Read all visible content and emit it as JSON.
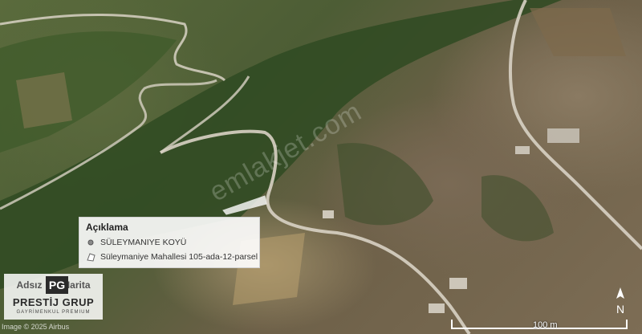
{
  "legend": {
    "title": "Açıklama",
    "items": [
      {
        "label": "SÜLEYMANIYE KOYÜ",
        "icon": "pin-icon"
      },
      {
        "label": "Süleymaniye Mahallesi 105-ada-12-parsel",
        "icon": "polygon-icon"
      }
    ]
  },
  "watermark": "emlakjet.com",
  "logo": {
    "left": "Adsız",
    "right": "Harita",
    "mark": "PG",
    "name": "PRESTİJ GRUP",
    "tagline": "GAYRİMENKUL PREMIUM"
  },
  "imagery_credit": "Image © 2025 Airbus",
  "scale": {
    "label": "100 m"
  },
  "north": {
    "label": "N"
  },
  "colors": {
    "road": "#d8d2c4",
    "parcel": "#ffffff",
    "forest": "#2f4a22"
  }
}
